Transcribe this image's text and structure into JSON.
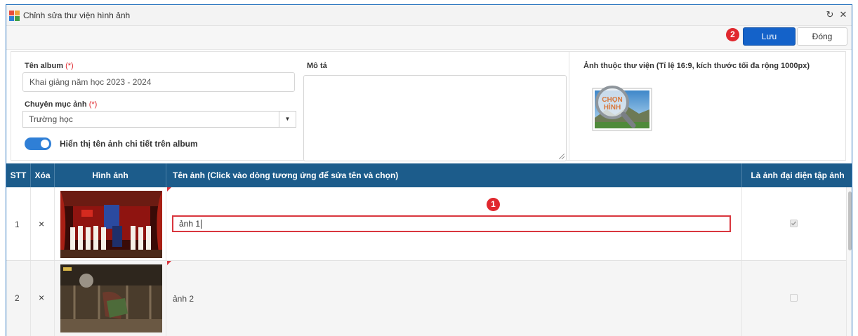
{
  "window": {
    "title": "Chỉnh sửa thư viện hình ảnh"
  },
  "toolbar": {
    "save_label": "Lưu",
    "close_label": "Đóng",
    "step_badge": "2"
  },
  "form": {
    "album_name_label": "Tên album",
    "album_name_value": "Khai giảng năm học 2023 - 2024",
    "required_mark": "(*)",
    "category_label": "Chuyên mục ảnh",
    "category_value": "Trường học",
    "toggle_label": "Hiển thị tên ảnh chi tiết trên album",
    "toggle_on": true,
    "description_label": "Mô tả",
    "description_value": "",
    "library_image_label": "Ảnh thuộc thư viện (Tỉ lệ 16:9, kích thước tối đa rộng 1000px)",
    "library_image_button_text": "CHỌN HÌNH"
  },
  "table": {
    "columns": [
      "STT",
      "Xóa",
      "Hình ảnh",
      "Tên ảnh (Click vào dòng tương ứng để sửa tên và chọn)",
      "Là ảnh đại diện tập ảnh"
    ],
    "rows": [
      {
        "stt": "1",
        "delete": "×",
        "name": "ảnh 1",
        "is_cover": true,
        "editing": true,
        "step_badge": "1"
      },
      {
        "stt": "2",
        "delete": "×",
        "name": "ảnh 2",
        "is_cover": false,
        "editing": false
      }
    ]
  },
  "colors": {
    "header_bg": "#1c5c8b",
    "primary": "#1462c9",
    "badge": "#e0282e",
    "highlight_border": "#d9363e"
  }
}
